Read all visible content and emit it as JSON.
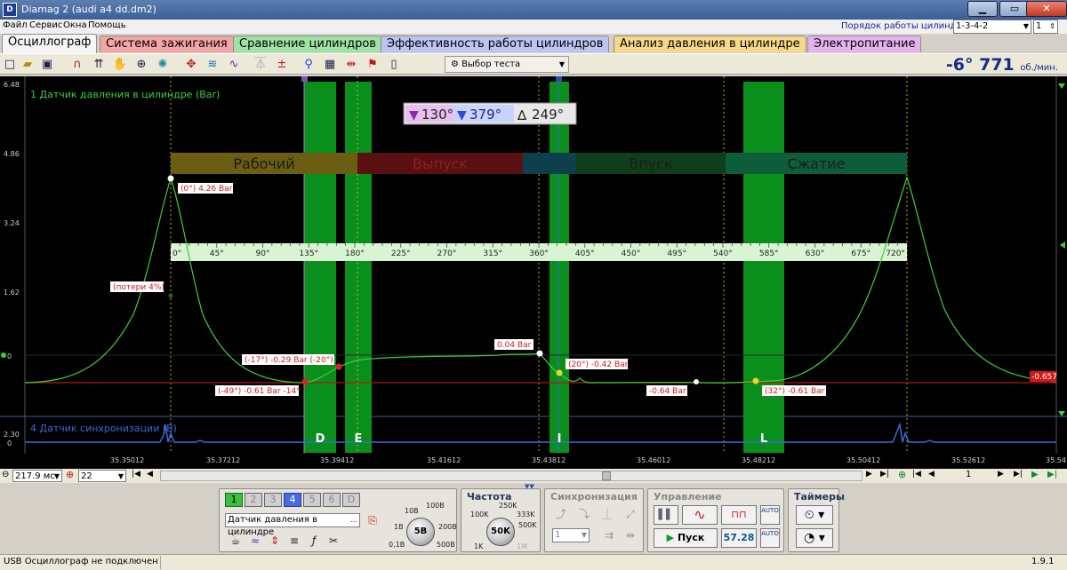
{
  "window": {
    "title": "Diamag 2 (audi a4 dd.dm2)"
  },
  "menu": [
    "Файл",
    "Сервис",
    "Окна",
    "Помощь"
  ],
  "cyl_order": {
    "label": "Порядок работы цилиндров",
    "value": "1-3-4-2",
    "spin": "1"
  },
  "tabs": [
    {
      "label": "Осциллограф",
      "color": "#e8e8e8",
      "active": true
    },
    {
      "label": "Система зажигания",
      "color": "#f4a6a6"
    },
    {
      "label": "Сравнение цилиндров",
      "color": "#9fe3a4"
    },
    {
      "label": "Эффективность работы цилиндров",
      "color": "#bcc4f2"
    },
    {
      "label": "Анализ давления в цилиндре",
      "color": "#f7d88a"
    },
    {
      "label": "Электропитание",
      "color": "#e6b3ef"
    }
  ],
  "toolbar": {
    "test_select": "Выбор теста",
    "rpm_value": "-6° 771",
    "rpm_unit": "об./мин."
  },
  "scope": {
    "y_labels": [
      "6.48",
      "4.86",
      "3.24",
      "1.62",
      "0",
      "2.30",
      "0"
    ],
    "channel1_label": "1 Датчик давления в цилиндре (Bar)",
    "channel4_label": "4 Датчик синхронизации (В)",
    "markers": {
      "m1": "130°",
      "m2": "379°",
      "delta": "249°"
    },
    "phases": [
      {
        "label": "Рабочий",
        "color": "#6b5d12"
      },
      {
        "label": "Выпуск",
        "color": "#5a1010"
      },
      {
        "label": "Впуск",
        "color": "#0f3f1a"
      },
      {
        "label": "Сжатие",
        "color": "#0d5d3a"
      }
    ],
    "degree_ticks": [
      "0°",
      "45°",
      "90°",
      "135°",
      "180°",
      "225°",
      "270°",
      "315°",
      "360°",
      "405°",
      "450°",
      "495°",
      "540°",
      "585°",
      "630°",
      "675°",
      "720°"
    ],
    "annotations": {
      "peak": "(0°) 4.26 Bar",
      "loss": "(потери 4%)",
      "p1": "(-17°) -0.29 Bar (-20°)",
      "p2": "(-49°) -0.61 Bar -14°",
      "p3": "0.04 Bar",
      "p4": "(20°) -0.42 Bar",
      "p5": "-0.64 Bar",
      "p6": "(32°) -0.61 Bar",
      "right_value": "-0.657"
    },
    "event_letters": [
      "D",
      "E",
      "I",
      "L"
    ],
    "time_ticks": [
      "35.35012",
      "35.37212",
      "35.39412",
      "35.41612",
      "35.43812",
      "35.46012",
      "35.48212",
      "35.50412",
      "35.52612",
      "35.54"
    ]
  },
  "timebar": {
    "timebase": "217.9 мс",
    "zoom": "22",
    "page": "1"
  },
  "controls": {
    "channels": [
      "1",
      "2",
      "3",
      "4",
      "5",
      "6",
      "D"
    ],
    "sensor": "Датчик давления в цилиндре",
    "volt_scale": {
      "labels": [
        "10В",
        "100В",
        "1В",
        "200В",
        "0,1В",
        "500В"
      ],
      "value": "5В"
    },
    "freq": {
      "title": "Частота",
      "labels": [
        "250K",
        "100K",
        "333K",
        "500K",
        "1K",
        "1M"
      ],
      "value": "50K"
    },
    "sync": {
      "title": "Синхронизация",
      "value": "1"
    },
    "control": {
      "title": "Управление",
      "start": "Пуск",
      "rate": "57.28"
    },
    "timers": {
      "title": "Таймеры"
    }
  },
  "status": {
    "left": "USB Осциллограф не подключен",
    "version": "1.9.1"
  }
}
